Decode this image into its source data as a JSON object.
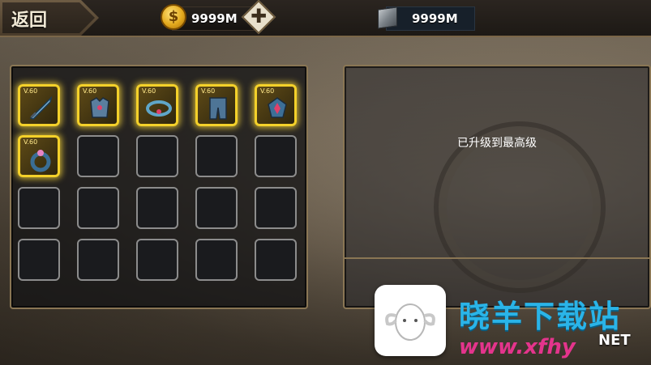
{
  "topbar": {
    "back_label": "返回",
    "gold_icon": "coin-icon",
    "gold_symbol": "$",
    "gold_value": "9999M",
    "add_icon": "plus-icon",
    "plus_glyph": "✚",
    "gem_icon": "cube-icon",
    "gem_value": "9999M"
  },
  "inventory": {
    "slots": [
      {
        "filled": true,
        "level": "V.60",
        "icon": "sword-icon"
      },
      {
        "filled": true,
        "level": "V.60",
        "icon": "chest-armor-icon"
      },
      {
        "filled": true,
        "level": "V.60",
        "icon": "belt-icon"
      },
      {
        "filled": true,
        "level": "V.60",
        "icon": "leg-armor-icon"
      },
      {
        "filled": true,
        "level": "V.60",
        "icon": "amulet-icon"
      },
      {
        "filled": true,
        "level": "V.60",
        "icon": "ring-icon"
      },
      {
        "filled": false
      },
      {
        "filled": false
      },
      {
        "filled": false
      },
      {
        "filled": false
      },
      {
        "filled": false
      },
      {
        "filled": false
      },
      {
        "filled": false
      },
      {
        "filled": false
      },
      {
        "filled": false
      },
      {
        "filled": false
      },
      {
        "filled": false
      },
      {
        "filled": false
      },
      {
        "filled": false
      },
      {
        "filled": false
      }
    ]
  },
  "detail": {
    "status": "已升级到最高级"
  },
  "watermark": {
    "title": "晓羊下载站",
    "url": "www.xfhy",
    "url_tail": "NET"
  },
  "colors": {
    "slot_highlight": "#f4d12a",
    "panel_border": "#8a7654",
    "watermark_blue": "#2ab4e8",
    "watermark_pink": "#e4348c"
  }
}
